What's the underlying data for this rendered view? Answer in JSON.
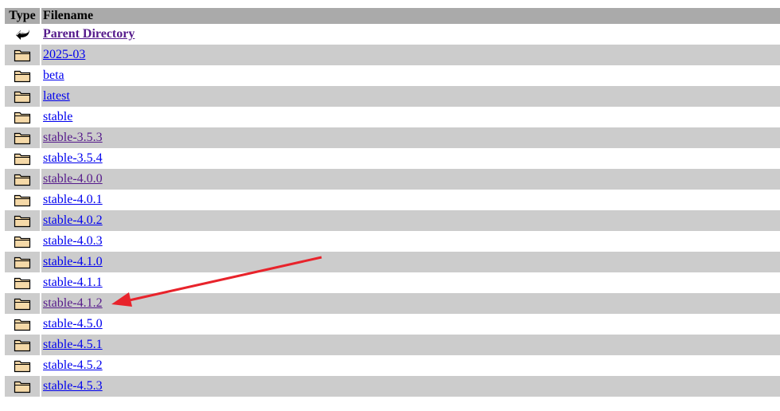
{
  "header": {
    "type_label": "Type",
    "filename_label": "Filename"
  },
  "parent": {
    "icon": "back-arrow-icon",
    "label": "Parent Directory"
  },
  "entries": [
    {
      "name": "2025-03",
      "icon": "folder-icon",
      "visited": false
    },
    {
      "name": "beta",
      "icon": "folder-icon",
      "visited": false
    },
    {
      "name": "latest",
      "icon": "folder-icon",
      "visited": false
    },
    {
      "name": "stable",
      "icon": "folder-icon",
      "visited": false
    },
    {
      "name": "stable-3.5.3",
      "icon": "folder-icon",
      "visited": true
    },
    {
      "name": "stable-3.5.4",
      "icon": "folder-icon",
      "visited": false
    },
    {
      "name": "stable-4.0.0",
      "icon": "folder-icon",
      "visited": true
    },
    {
      "name": "stable-4.0.1",
      "icon": "folder-icon",
      "visited": false
    },
    {
      "name": "stable-4.0.2",
      "icon": "folder-icon",
      "visited": false
    },
    {
      "name": "stable-4.0.3",
      "icon": "folder-icon",
      "visited": false
    },
    {
      "name": "stable-4.1.0",
      "icon": "folder-icon",
      "visited": false
    },
    {
      "name": "stable-4.1.1",
      "icon": "folder-icon",
      "visited": false
    },
    {
      "name": "stable-4.1.2",
      "icon": "folder-icon",
      "visited": true
    },
    {
      "name": "stable-4.5.0",
      "icon": "folder-icon",
      "visited": false
    },
    {
      "name": "stable-4.5.1",
      "icon": "folder-icon",
      "visited": false
    },
    {
      "name": "stable-4.5.2",
      "icon": "folder-icon",
      "visited": false
    },
    {
      "name": "stable-4.5.3",
      "icon": "folder-icon",
      "visited": false
    }
  ],
  "annotation": {
    "icon": "red-arrow-annotation",
    "color": "#e8232b"
  },
  "colors": {
    "header_bg": "#aaaaaa",
    "shaded_row_bg": "#cccccc",
    "link": "#0000ee",
    "visited_link": "#551a8b",
    "folder_fill": "#f5d9a8",
    "folder_stroke": "#000000"
  }
}
